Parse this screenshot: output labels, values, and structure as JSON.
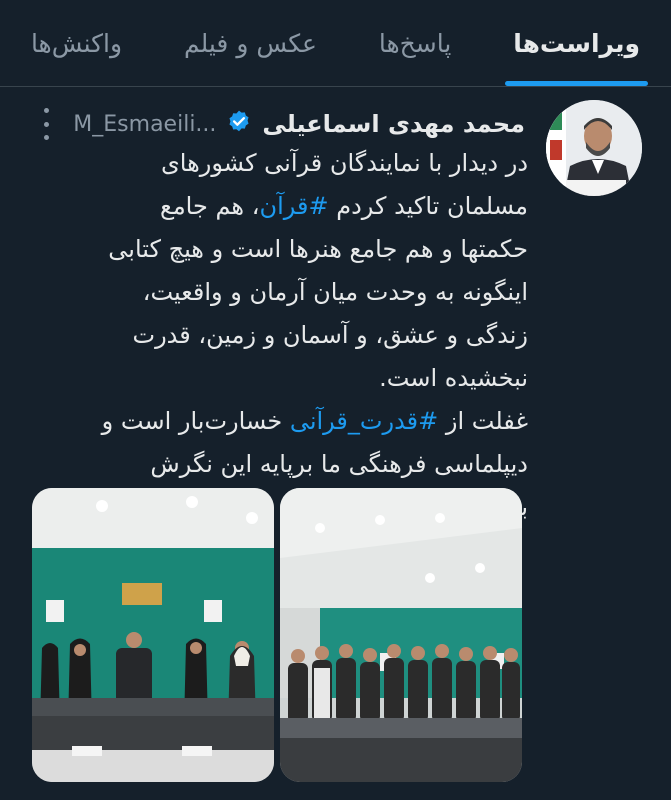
{
  "tabs": [
    {
      "label": "ویراست‌ها",
      "active": true
    },
    {
      "label": "پاسخ‌ها",
      "active": false
    },
    {
      "label": "عکس و فیلم",
      "active": false
    },
    {
      "label": "واکنش‌ها",
      "active": false
    }
  ],
  "tweet": {
    "author_name": "محمد مهدی اسماعیلی",
    "handle": "M_Esmaeili...",
    "verified_icon": "verified-badge-icon",
    "more_icon": "more-vertical-icon",
    "body_part1": "در دیدار با نمایندگان قرآنی کشورهای مسلمان تاکید کردم",
    "hashtag1": "#قرآن",
    "body_part2": "، هم جامع حکمتها و هم جامع هنرها است و هیچ کتابی اینگونه به وحدت میان آرمان و واقعیت، زندگی و عشق، و آسمان و زمین، قدرت نبخشیده است.",
    "body_part3": "غفلت از",
    "hashtag2": "#قدرت_قرآنی",
    "body_part4": "خسارت‌بار است و دیپلماسی فرهنگی ما برپایه این نگرش بازتنظیم شده است."
  },
  "colors": {
    "background": "#15202b",
    "text": "#e7e9ea",
    "muted": "#8b98a5",
    "accent": "#1d9bf0",
    "divider": "#38444d"
  }
}
